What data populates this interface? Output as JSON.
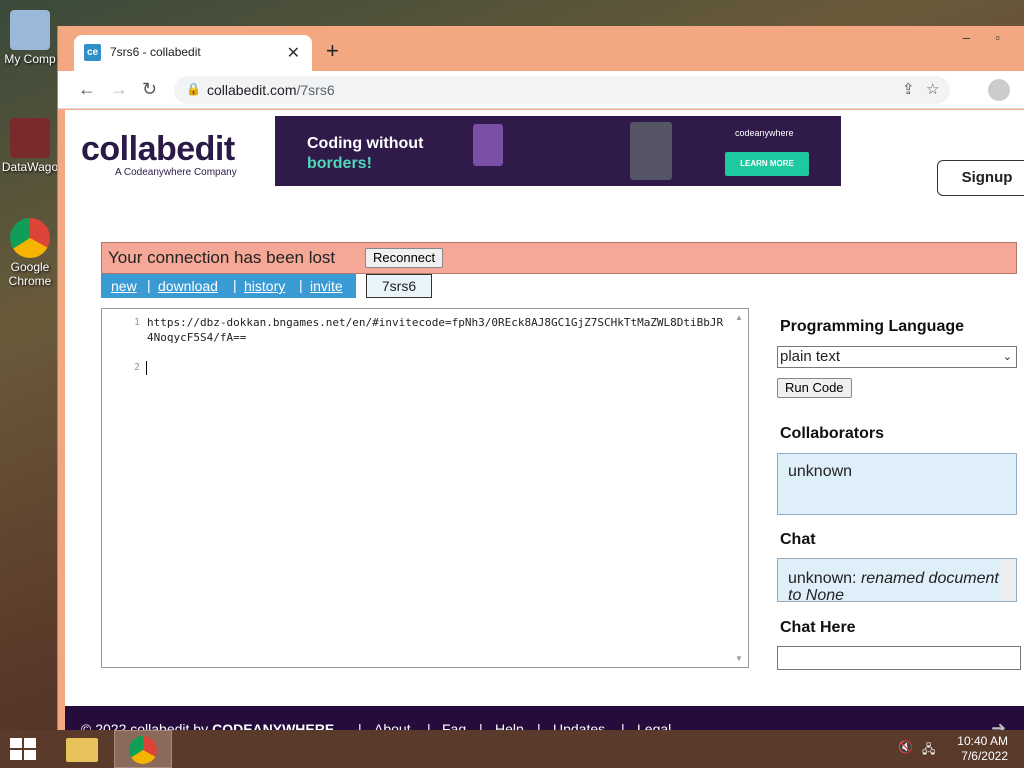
{
  "desktop": {
    "icons": [
      {
        "label": "My Comp"
      },
      {
        "label": "DataWago"
      },
      {
        "label": "Google Chrome"
      }
    ]
  },
  "browser": {
    "tab_title": "7srs6 - collabedit",
    "tab_favicon": "ce",
    "url_host": "collabedit.com",
    "url_path": "/7srs6"
  },
  "site": {
    "logo": "collabedit",
    "logo_sub": "A Codeanywhere Company",
    "banner": {
      "line1": "Coding without",
      "line2": "borders!",
      "brand": "codeanywhere",
      "cta": "LEARN MORE"
    },
    "signup": "Signup",
    "connection_msg": "Your connection has been lost",
    "reconnect": "Reconnect",
    "menu": [
      "new",
      "download",
      "history",
      "invite"
    ],
    "doc_id": "7srs6"
  },
  "editor": {
    "line_numbers": [
      "1",
      "2"
    ],
    "code": "https://dbz-dokkan.bngames.net/en/#invitecode=fpNh3/0REck8AJ8GC1GjZ7SCHkTtMaZWL8DtiBbJR4NoqycF5S4/fA=="
  },
  "sidebar": {
    "lang_heading": "Programming Language",
    "lang_value": "plain text",
    "run_code": "Run Code",
    "collab_heading": "Collaborators",
    "collaborator": "unknown",
    "chat_heading": "Chat",
    "chat_user": "unknown:",
    "chat_msg": "renamed document to None",
    "chat_here": "Chat Here"
  },
  "footer": {
    "copy": "© 2022 collabedit by",
    "brand": "CODEANYWHERE",
    "links": [
      "About",
      "Faq",
      "Help",
      "Updates",
      "Legal"
    ]
  },
  "taskbar": {
    "time": "10:40 AM",
    "date": "7/6/2022"
  }
}
